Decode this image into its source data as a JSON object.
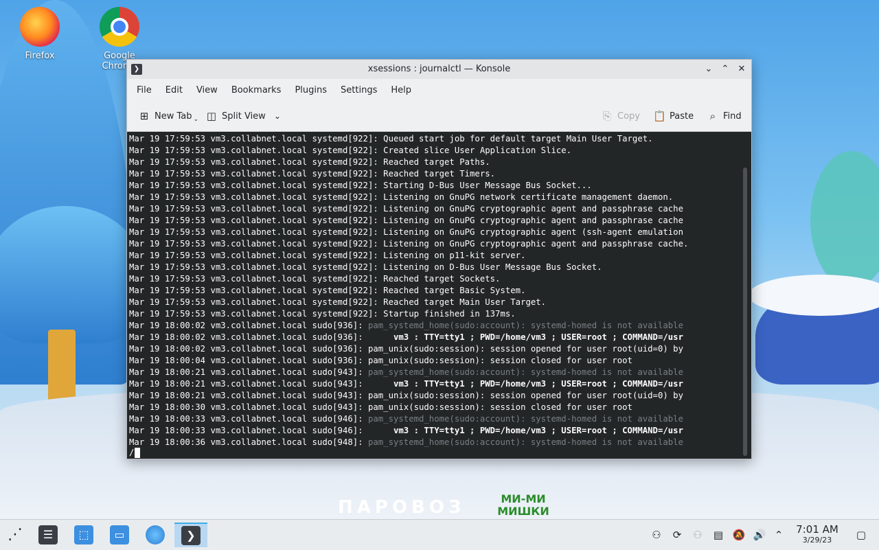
{
  "desktop": {
    "icons": [
      {
        "label": "Firefox"
      },
      {
        "label": "Google Chrome"
      }
    ],
    "wallpaper_text": {
      "logo1": "ПАРОВОЗ",
      "logo2_line1": "МИ-МИ",
      "logo2_line2": "МИШКИ"
    }
  },
  "window": {
    "title": "xsessions : journalctl — Konsole",
    "menu": [
      "File",
      "Edit",
      "View",
      "Bookmarks",
      "Plugins",
      "Settings",
      "Help"
    ],
    "toolbar": {
      "new_tab": "New Tab",
      "split_view": "Split View",
      "copy": "Copy",
      "paste": "Paste",
      "find": "Find"
    },
    "terminal": {
      "lines": [
        "Mar 19 17:59:53 vm3.collabnet.local systemd[922]: Queued start job for default target Main User Target.",
        "Mar 19 17:59:53 vm3.collabnet.local systemd[922]: Created slice User Application Slice.",
        "Mar 19 17:59:53 vm3.collabnet.local systemd[922]: Reached target Paths.",
        "Mar 19 17:59:53 vm3.collabnet.local systemd[922]: Reached target Timers.",
        "Mar 19 17:59:53 vm3.collabnet.local systemd[922]: Starting D-Bus User Message Bus Socket...",
        "Mar 19 17:59:53 vm3.collabnet.local systemd[922]: Listening on GnuPG network certificate management daemon.",
        "Mar 19 17:59:53 vm3.collabnet.local systemd[922]: Listening on GnuPG cryptographic agent and passphrase cache",
        "Mar 19 17:59:53 vm3.collabnet.local systemd[922]: Listening on GnuPG cryptographic agent and passphrase cache",
        "Mar 19 17:59:53 vm3.collabnet.local systemd[922]: Listening on GnuPG cryptographic agent (ssh-agent emulation",
        "Mar 19 17:59:53 vm3.collabnet.local systemd[922]: Listening on GnuPG cryptographic agent and passphrase cache.",
        "Mar 19 17:59:53 vm3.collabnet.local systemd[922]: Listening on p11-kit server.",
        "Mar 19 17:59:53 vm3.collabnet.local systemd[922]: Listening on D-Bus User Message Bus Socket.",
        "Mar 19 17:59:53 vm3.collabnet.local systemd[922]: Reached target Sockets.",
        "Mar 19 17:59:53 vm3.collabnet.local systemd[922]: Reached target Basic System.",
        "Mar 19 17:59:53 vm3.collabnet.local systemd[922]: Reached target Main User Target.",
        "Mar 19 17:59:53 vm3.collabnet.local systemd[922]: Startup finished in 137ms.",
        "Mar 19 18:00:02 vm3.collabnet.local sudo[936]: pam_systemd_home(sudo:account): systemd-homed is not available",
        "Mar 19 18:00:02 vm3.collabnet.local sudo[936]:      vm3 : TTY=tty1 ; PWD=/home/vm3 ; USER=root ; COMMAND=/usr",
        "Mar 19 18:00:02 vm3.collabnet.local sudo[936]: pam_unix(sudo:session): session opened for user root(uid=0) by",
        "Mar 19 18:00:04 vm3.collabnet.local sudo[936]: pam_unix(sudo:session): session closed for user root",
        "Mar 19 18:00:21 vm3.collabnet.local sudo[943]: pam_systemd_home(sudo:account): systemd-homed is not available",
        "Mar 19 18:00:21 vm3.collabnet.local sudo[943]:      vm3 : TTY=tty1 ; PWD=/home/vm3 ; USER=root ; COMMAND=/usr",
        "Mar 19 18:00:21 vm3.collabnet.local sudo[943]: pam_unix(sudo:session): session opened for user root(uid=0) by",
        "Mar 19 18:00:30 vm3.collabnet.local sudo[943]: pam_unix(sudo:session): session closed for user root",
        "Mar 19 18:00:33 vm3.collabnet.local sudo[946]: pam_systemd_home(sudo:account): systemd-homed is not available",
        "Mar 19 18:00:33 vm3.collabnet.local sudo[946]:      vm3 : TTY=tty1 ; PWD=/home/vm3 ; USER=root ; COMMAND=/usr",
        "Mar 19 18:00:36 vm3.collabnet.local sudo[948]: pam_systemd_home(sudo:account): systemd-homed is not available"
      ],
      "prompt": "/"
    }
  },
  "taskbar": {
    "clock_time": "7:01 AM",
    "clock_date": "3/29/23"
  },
  "colors": {
    "terminal_bg": "#232627",
    "terminal_fg": "#fcfcfc",
    "active_task": "#b9d7f1"
  }
}
